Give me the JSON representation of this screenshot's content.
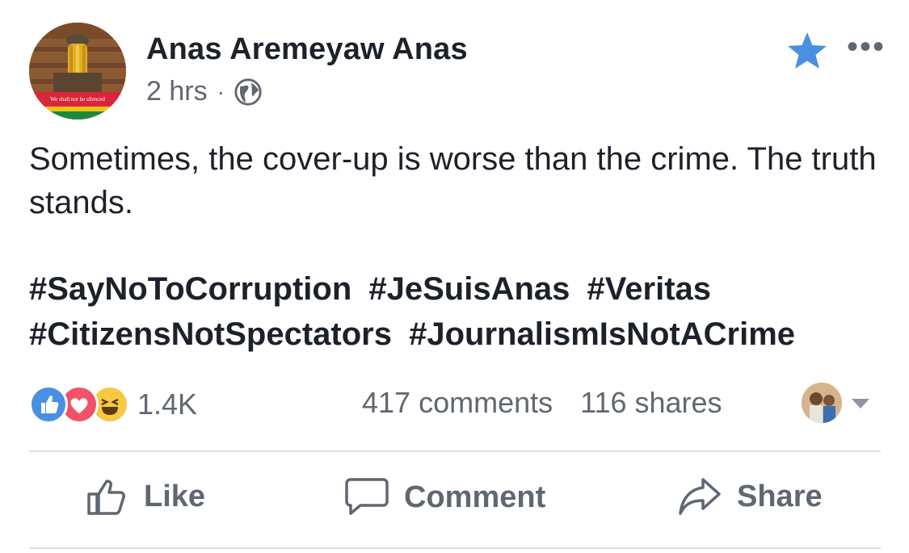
{
  "post": {
    "author": "Anas Aremeyaw Anas",
    "time": "2 hrs",
    "separator": "·",
    "text": "Sometimes, the cover-up is worse than the crime. The truth stands.",
    "hashtags": [
      "#SayNoToCorruption",
      "#JeSuisAnas",
      "#Veritas",
      "#CitizensNotSpectators",
      "#JournalismIsNotACrime"
    ],
    "avatar_banner_text": "We shall not be silenced"
  },
  "engagement": {
    "reaction_count": "1.4K",
    "comments": "417 comments",
    "shares": "116 shares",
    "reactions": [
      "like-icon",
      "love-icon",
      "haha-icon"
    ]
  },
  "actions": {
    "like": "Like",
    "comment": "Comment",
    "share": "Share"
  },
  "colors": {
    "brand_blue": "#4a90e2",
    "text": "#1d2129",
    "secondary": "#616770",
    "divider": "#dddfe2",
    "love_red": "#f25268",
    "haha_yellow": "#f7c844"
  }
}
